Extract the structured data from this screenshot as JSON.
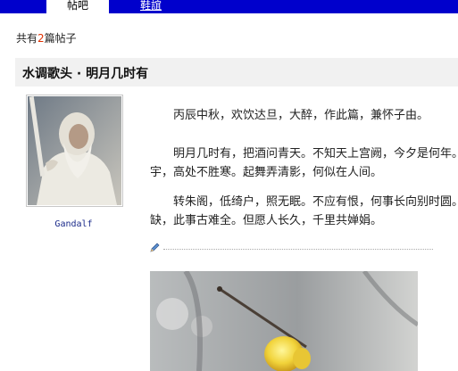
{
  "tabs": [
    {
      "label": "帖吧",
      "active": true
    },
    {
      "label": "鞋誼",
      "active": false
    }
  ],
  "thread_count": {
    "prefix": "共有",
    "number": "2",
    "suffix": "篇帖子"
  },
  "post": {
    "title": "水调歌头 · 明月几时有",
    "author": "Gandalf",
    "paragraphs": [
      [
        "丙辰中秋，欢饮达旦，大醉，作此篇，兼怀子由。"
      ],
      [
        "明月几时有，把酒问青天。不知天上宫阙，今夕是何年。",
        "宇，高处不胜寒。起舞弄清影，何似在人间。"
      ],
      [
        "转朱阁，低绮户，照无眠。不应有恨，何事长向别时圆。",
        "缺，此事古难全。但愿人长久，千里共婵娟。"
      ]
    ]
  },
  "colors": {
    "tab_bar": "#0000cc",
    "title_bg": "#f1f1f1",
    "count_number": "#e03000",
    "author_link": "#1a2a8a"
  },
  "icons": {
    "edit": "pencil-icon"
  }
}
